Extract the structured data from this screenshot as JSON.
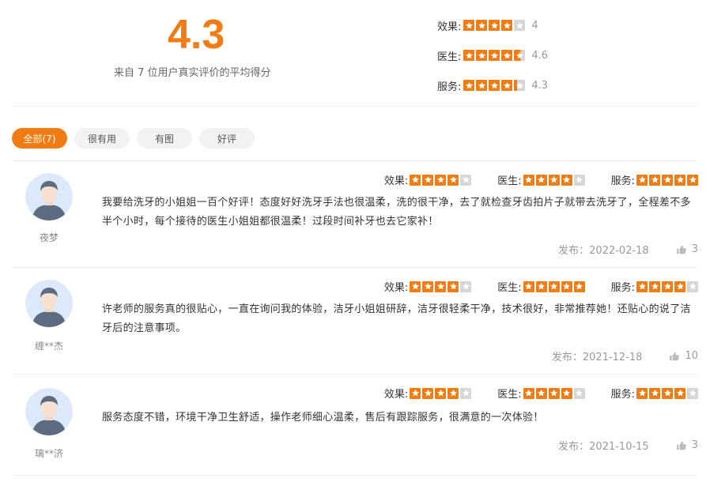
{
  "summary": {
    "score": "4.3",
    "caption": "来自 7 位用户真实评价的平均得分",
    "aggregates": [
      {
        "label": "效果:",
        "value": "4",
        "rating": 4
      },
      {
        "label": "医生:",
        "value": "4.6",
        "rating": 4.6
      },
      {
        "label": "服务:",
        "value": "4.3",
        "rating": 4.3
      }
    ]
  },
  "filters": [
    {
      "label": "全部(7)",
      "active": true
    },
    {
      "label": "很有用",
      "active": false
    },
    {
      "label": "有图",
      "active": false
    },
    {
      "label": "好评",
      "active": false
    }
  ],
  "rating_labels": {
    "effect": "效果:",
    "doctor": "医生:",
    "service": "服务:"
  },
  "reviews": [
    {
      "user": "夜梦",
      "ratings": {
        "effect": 4,
        "doctor": 4,
        "service": 5
      },
      "text": "我要给洗牙的小姐姐一百个好评！态度好好洗牙手法也很温柔，洗的很干净，去了就检查牙齿拍片子就带去洗牙了，全程差不多半个小时，每个接待的医生小姐姐都很温柔！过段时间补牙也去它家补！",
      "date": "发布：2022-02-18",
      "likes": "3"
    },
    {
      "user": "缠**杰",
      "ratings": {
        "effect": 4,
        "doctor": 5,
        "service": 4
      },
      "text": "许老师的服务真的很贴心，一直在询问我的体验，洁牙小姐姐研辞，洁牙很轻柔干净，技术很好，非常推荐她！还贴心的说了洁牙后的注意事项。",
      "date": "发布：2021-12-18",
      "likes": "10"
    },
    {
      "user": "璃**济",
      "ratings": {
        "effect": 4,
        "doctor": 4,
        "service": 4
      },
      "text": "服务态度不错，环境干净卫生舒适，操作老师细心温柔，售后有跟踪服务，很满意的一次体验！",
      "date": "发布：2021-10-15",
      "likes": "3"
    }
  ],
  "colors": {
    "accent": "#f07c13",
    "star_empty": "#d6d6d6",
    "muted": "#999999"
  },
  "icons": {
    "star": "star-icon",
    "like": "thumbs-up-icon",
    "avatar": "user-avatar-icon"
  }
}
